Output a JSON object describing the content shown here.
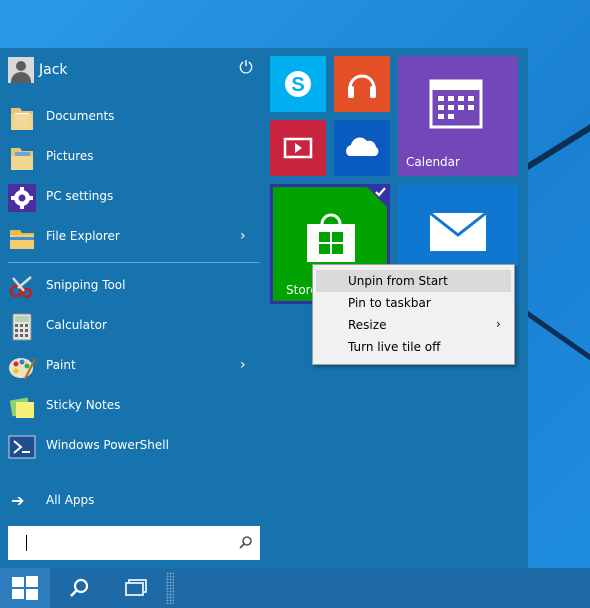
{
  "user": {
    "name": "Jack"
  },
  "icons": {
    "power": "power-icon",
    "search": "search-icon",
    "windows": "windows-logo-icon",
    "task_view": "task-view-icon"
  },
  "left_items": [
    {
      "label": "Documents",
      "icon": "documents-folder-icon"
    },
    {
      "label": "Pictures",
      "icon": "pictures-folder-icon"
    },
    {
      "label": "PC settings",
      "icon": "gear-icon"
    },
    {
      "label": "File Explorer",
      "icon": "file-explorer-icon",
      "submenu": true
    },
    {
      "label": "Snipping Tool",
      "icon": "snipping-tool-icon"
    },
    {
      "label": "Calculator",
      "icon": "calculator-icon"
    },
    {
      "label": "Paint",
      "icon": "paint-palette-icon",
      "submenu": true
    },
    {
      "label": "Sticky Notes",
      "icon": "sticky-notes-icon"
    },
    {
      "label": "Windows PowerShell",
      "icon": "powershell-icon"
    }
  ],
  "all_apps": {
    "label": "All Apps",
    "icon": "arrow-right-icon"
  },
  "search": {
    "placeholder": ""
  },
  "tiles": [
    {
      "name": "Skype",
      "label": "",
      "color": "#00aff0",
      "icon": "skype-icon"
    },
    {
      "name": "Music",
      "label": "",
      "color": "#e34f26",
      "icon": "headphones-icon"
    },
    {
      "name": "Calendar",
      "label": "Calendar",
      "color": "#7247b8",
      "icon": "calendar-icon"
    },
    {
      "name": "Video",
      "label": "",
      "color": "#c9243f",
      "icon": "video-icon"
    },
    {
      "name": "OneDrive",
      "label": "",
      "color": "#0a5bbf",
      "icon": "cloud-icon"
    },
    {
      "name": "Store",
      "label": "Store",
      "color": "#00a300",
      "icon": "store-bag-icon",
      "selected": true
    },
    {
      "name": "Mail",
      "label": "",
      "color": "#0f77d0",
      "icon": "mail-icon"
    }
  ],
  "context_menu": {
    "items": [
      {
        "label": "Unpin from Start",
        "highlighted": true
      },
      {
        "label": "Pin to taskbar"
      },
      {
        "label": "Resize",
        "submenu": true
      },
      {
        "label": "Turn live tile off"
      }
    ]
  },
  "colors": {
    "start_bg": "#1673ad",
    "taskbar": "#1d6aa6",
    "selection": "#3333a8"
  }
}
